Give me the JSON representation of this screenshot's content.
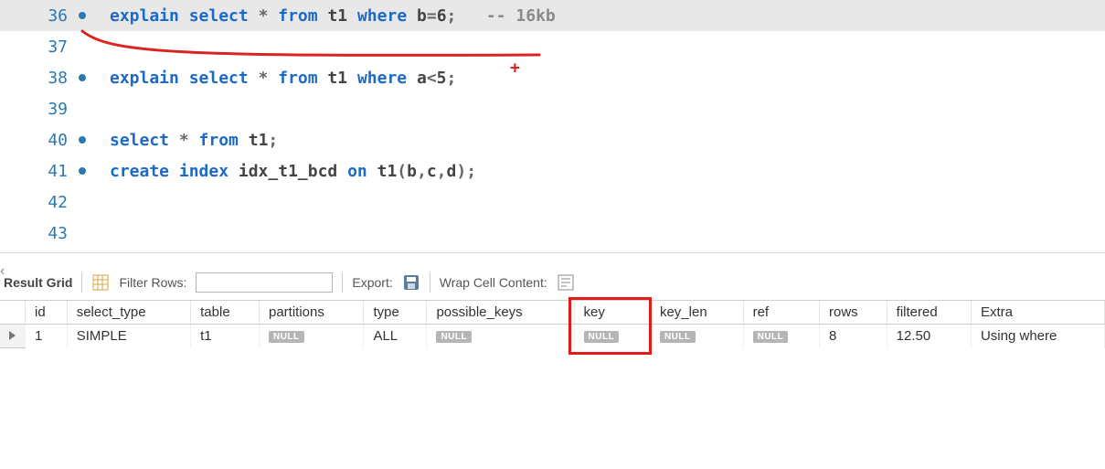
{
  "editor": {
    "lines": [
      {
        "num": 36,
        "dot": true,
        "hl": true,
        "tokens": [
          [
            "kw",
            "explain "
          ],
          [
            "kw",
            "select"
          ],
          [
            "op",
            " * "
          ],
          [
            "kw",
            "from"
          ],
          [
            "id",
            " t1 "
          ],
          [
            "kw",
            "where"
          ],
          [
            "id",
            " b"
          ],
          [
            "op",
            "="
          ],
          [
            "id",
            "6"
          ],
          [
            "op",
            ";   "
          ],
          [
            "cm",
            "-- 16kb"
          ]
        ]
      },
      {
        "num": 37,
        "dot": false,
        "hl": false,
        "tokens": []
      },
      {
        "num": 38,
        "dot": true,
        "hl": false,
        "tokens": [
          [
            "kw",
            "explain select"
          ],
          [
            "op",
            " * "
          ],
          [
            "kw",
            "from"
          ],
          [
            "id",
            " t1 "
          ],
          [
            "kw",
            "where"
          ],
          [
            "id",
            " a"
          ],
          [
            "op",
            "<"
          ],
          [
            "id",
            "5"
          ],
          [
            "op",
            ";"
          ]
        ]
      },
      {
        "num": 39,
        "dot": false,
        "hl": false,
        "tokens": []
      },
      {
        "num": 40,
        "dot": true,
        "hl": false,
        "tokens": [
          [
            "kw",
            "select"
          ],
          [
            "op",
            " * "
          ],
          [
            "kw",
            "from"
          ],
          [
            "id",
            " t1"
          ],
          [
            "op",
            ";"
          ]
        ]
      },
      {
        "num": 41,
        "dot": true,
        "hl": false,
        "tokens": [
          [
            "kw",
            "create index"
          ],
          [
            "id",
            " idx_t1_bcd "
          ],
          [
            "kw",
            "on"
          ],
          [
            "id",
            " t1"
          ],
          [
            "op",
            "("
          ],
          [
            "id",
            "b"
          ],
          [
            "op",
            ","
          ],
          [
            "id",
            "c"
          ],
          [
            "op",
            ","
          ],
          [
            "id",
            "d"
          ],
          [
            "op",
            ")"
          ],
          [
            "op",
            ";"
          ]
        ]
      },
      {
        "num": 42,
        "dot": false,
        "hl": false,
        "tokens": []
      },
      {
        "num": 43,
        "dot": false,
        "hl": false,
        "tokens": []
      }
    ]
  },
  "annotations": {
    "plus": "+"
  },
  "toolbar": {
    "result_grid_label": "Result Grid",
    "filter_rows_label": "Filter Rows:",
    "filter_value": "",
    "export_label": "Export:",
    "wrap_label": "Wrap Cell Content:"
  },
  "grid": {
    "columns": [
      "id",
      "select_type",
      "table",
      "partitions",
      "type",
      "possible_keys",
      "key",
      "key_len",
      "ref",
      "rows",
      "filtered",
      "Extra"
    ],
    "row": {
      "id": "1",
      "select_type": "SIMPLE",
      "table": "t1",
      "partitions": null,
      "type": "ALL",
      "possible_keys": null,
      "key": null,
      "key_len": null,
      "ref": null,
      "rows": "8",
      "filtered": "12.50",
      "Extra": "Using where"
    },
    "null_label": "NULL"
  }
}
